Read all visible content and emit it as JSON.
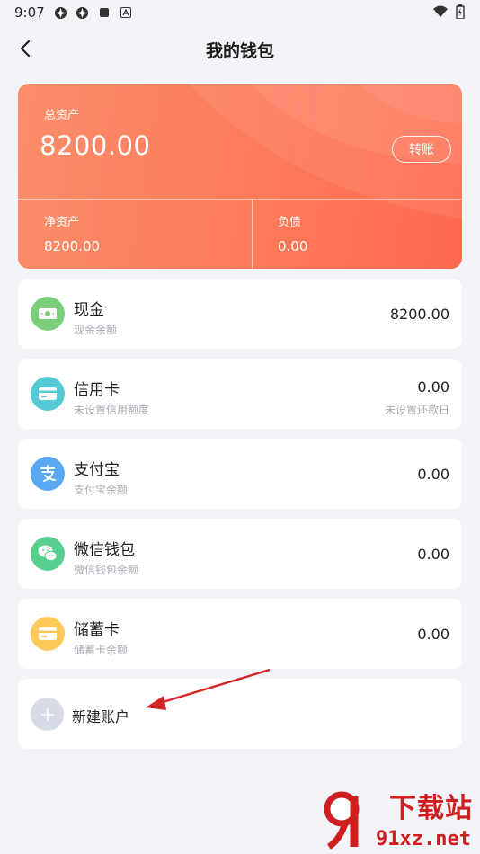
{
  "status_bar": {
    "time": "9:07"
  },
  "header": {
    "title": "我的钱包"
  },
  "summary": {
    "total_label": "总资产",
    "total_value": "8200.00",
    "transfer_label": "转账",
    "net_label": "净资产",
    "net_value": "8200.00",
    "debt_label": "负债",
    "debt_value": "0.00"
  },
  "accounts": [
    {
      "name": "现金",
      "sub": "现金余额",
      "amount": "8200.00",
      "color": "#7ccf7a"
    },
    {
      "name": "信用卡",
      "sub": "未设置信用额度",
      "amount": "0.00",
      "due": "未设置还款日",
      "color": "#55c9d4"
    },
    {
      "name": "支付宝",
      "sub": "支付宝余额",
      "amount": "0.00",
      "color": "#5aa7f2"
    },
    {
      "name": "微信钱包",
      "sub": "微信钱包余额",
      "amount": "0.00",
      "color": "#57cf8e"
    },
    {
      "name": "储蓄卡",
      "sub": "储蓄卡余额",
      "amount": "0.00",
      "color": "#fdc95a"
    }
  ],
  "new_account": {
    "label": "新建账户"
  },
  "watermark": {
    "text1": "下载站",
    "text2": "91xz.net"
  },
  "colors": {
    "card_gradient_start": "#fb8e6a",
    "card_gradient_end": "#ff6a4e",
    "arrow": "#d42424"
  }
}
